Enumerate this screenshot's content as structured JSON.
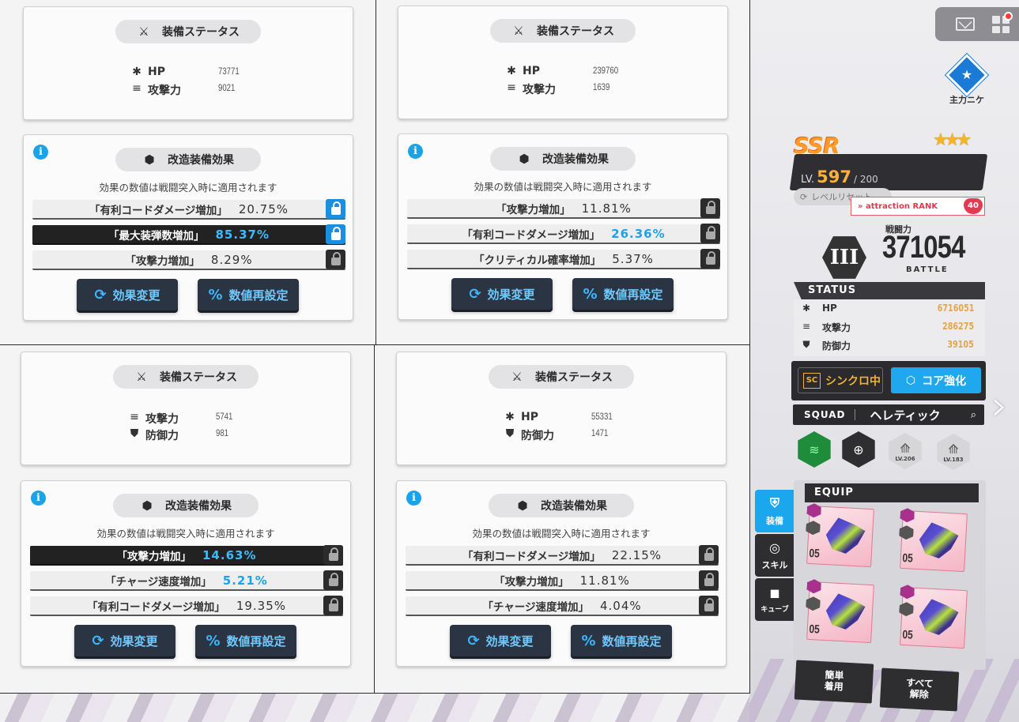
{
  "panels": [
    {
      "equip_title": "装備ステータス",
      "stats": [
        {
          "icon": "hp-icon",
          "label": "HP",
          "value": "73771"
        },
        {
          "icon": "attack-icon",
          "label": "攻撃力",
          "value": "9021"
        }
      ],
      "mod_title": "改造装備効果",
      "note": "効果の数値は戦闘突入時に適用されます",
      "effects": [
        {
          "name": "「有利コードダメージ増加」",
          "value": "20.75%",
          "dark": false,
          "blue_value": false,
          "locked_blue": true
        },
        {
          "name": "「最大装弾数増加」",
          "value": "85.37%",
          "dark": true,
          "blue_value": true,
          "locked_blue": true
        },
        {
          "name": "「攻撃力増加」",
          "value": "8.29%",
          "dark": false,
          "blue_value": false,
          "locked_blue": false
        }
      ],
      "btn_change": "効果変更",
      "btn_reset": "数値再設定"
    },
    {
      "equip_title": "装備ステータス",
      "stats": [
        {
          "icon": "hp-icon",
          "label": "HP",
          "value": "239760"
        },
        {
          "icon": "attack-icon",
          "label": "攻撃力",
          "value": "1639"
        }
      ],
      "mod_title": "改造装備効果",
      "note": "効果の数値は戦闘突入時に適用されます",
      "effects": [
        {
          "name": "「攻撃力増加」",
          "value": "11.81%",
          "dark": false,
          "blue_value": false,
          "locked_blue": false
        },
        {
          "name": "「有利コードダメージ増加」",
          "value": "26.36%",
          "dark": false,
          "blue_value": true,
          "locked_blue": false
        },
        {
          "name": "「クリティカル確率増加」",
          "value": "5.37%",
          "dark": false,
          "blue_value": false,
          "locked_blue": false
        }
      ],
      "btn_change": "効果変更",
      "btn_reset": "数値再設定"
    },
    {
      "equip_title": "装備ステータス",
      "stats": [
        {
          "icon": "attack-icon",
          "label": "攻撃力",
          "value": "5741"
        },
        {
          "icon": "defense-icon",
          "label": "防御力",
          "value": "981"
        }
      ],
      "mod_title": "改造装備効果",
      "note": "効果の数値は戦闘突入時に適用されます",
      "effects": [
        {
          "name": "「攻撃力増加」",
          "value": "14.63%",
          "dark": true,
          "blue_value": true,
          "locked_blue": false
        },
        {
          "name": "「チャージ速度増加」",
          "value": "5.21%",
          "dark": false,
          "blue_value": true,
          "locked_blue": false
        },
        {
          "name": "「有利コードダメージ増加」",
          "value": "19.35%",
          "dark": false,
          "blue_value": false,
          "locked_blue": false
        }
      ],
      "btn_change": "効果変更",
      "btn_reset": "数値再設定"
    },
    {
      "equip_title": "装備ステータス",
      "stats": [
        {
          "icon": "hp-icon",
          "label": "HP",
          "value": "55331"
        },
        {
          "icon": "defense-icon",
          "label": "防御力",
          "value": "1471"
        }
      ],
      "mod_title": "改造装備効果",
      "note": "効果の数値は戦闘突入時に適用されます",
      "effects": [
        {
          "name": "「有利コードダメージ増加」",
          "value": "22.15%",
          "dark": false,
          "blue_value": false,
          "locked_blue": false
        },
        {
          "name": "「攻撃力増加」",
          "value": "11.81%",
          "dark": false,
          "blue_value": false,
          "locked_blue": false
        },
        {
          "name": "「チャージ速度増加」",
          "value": "4.04%",
          "dark": false,
          "blue_value": false,
          "locked_blue": false
        }
      ],
      "btn_change": "効果変更",
      "btn_reset": "数値再設定"
    }
  ],
  "right": {
    "main_nikke_label": "主力ニケ",
    "rarity": "SSR",
    "level_prefix": "LV.",
    "level": "597",
    "level_max": "/ 200",
    "level_reset": "レベルリセット",
    "attraction_label": "» attraction RANK",
    "attraction_rank": "40",
    "power_label": "戦闘力",
    "power_value": "371054",
    "battle_label": "BATTLE",
    "limit_break": "III",
    "status_title": "STATUS",
    "status": [
      {
        "icon": "hp-icon",
        "label": "HP",
        "value": "6716051"
      },
      {
        "icon": "attack-icon",
        "label": "攻撃力",
        "value": "286275"
      },
      {
        "icon": "defense-icon",
        "label": "防御力",
        "value": "39105"
      }
    ],
    "synchro_badge": "SC",
    "synchro_label": "シンクロ中",
    "core_label": "コア強化",
    "squad_label": "SQUAD",
    "squad_name": "ヘレティック",
    "skill_levels": [
      "LV.206",
      "LV.183"
    ],
    "tabs": [
      "装備",
      "スキル",
      "キューブ"
    ],
    "equip_title": "EQUIP",
    "equip_levels": [
      "05",
      "05",
      "05",
      "05"
    ],
    "btn_easy_equip": "簡単\n着用",
    "btn_unequip_all": "すべて\n解除",
    "accent_color": "#1aa7ee",
    "value_color": "#e5a54a"
  }
}
